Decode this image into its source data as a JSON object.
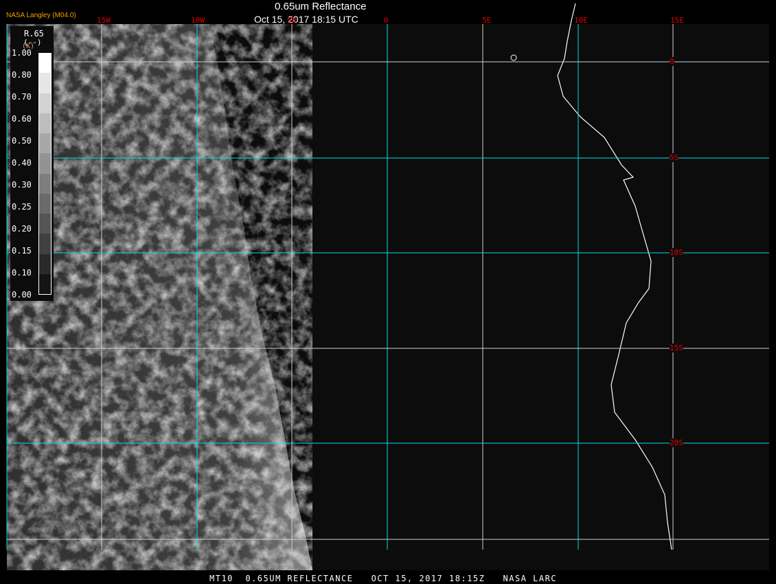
{
  "header": {
    "title": "0.65um Reflectance",
    "datetime": "Oct 15, 2017 18:15 UTC",
    "brand": "NASA Langley (M04.0)"
  },
  "longitude_labels": [
    "15W",
    "10W",
    "5W",
    "0",
    "5E",
    "10E",
    "15E"
  ],
  "latitude_labels": [
    "0",
    "5S",
    "10S",
    "15S",
    "20S"
  ],
  "legend": {
    "variable": "R.65",
    "unit": "(--)",
    "unit_alt": "(K)",
    "ticks": [
      "1.00",
      "0.80",
      "0.70",
      "0.60",
      "0.50",
      "0.40",
      "0.30",
      "0.25",
      "0.20",
      "0.15",
      "0.10",
      "0.00"
    ],
    "colors": [
      "#ffffff",
      "#e6e6e6",
      "#d2d2d2",
      "#bdbdbd",
      "#a8a8a8",
      "#939393",
      "#7e7e7e",
      "#6a6a6a",
      "#555555",
      "#404040",
      "#2a2a2a",
      "#141414"
    ]
  },
  "colors": {
    "grid_primary": "#00e0e8",
    "grid_secondary": "#d0d0d0",
    "label": "#e00000",
    "brand": "#f0a000",
    "background": "#0c0c0c"
  },
  "footer": "MT10  0.65UM REFLECTANCE   OCT 15, 2017 18:15Z   NASA LARC"
}
